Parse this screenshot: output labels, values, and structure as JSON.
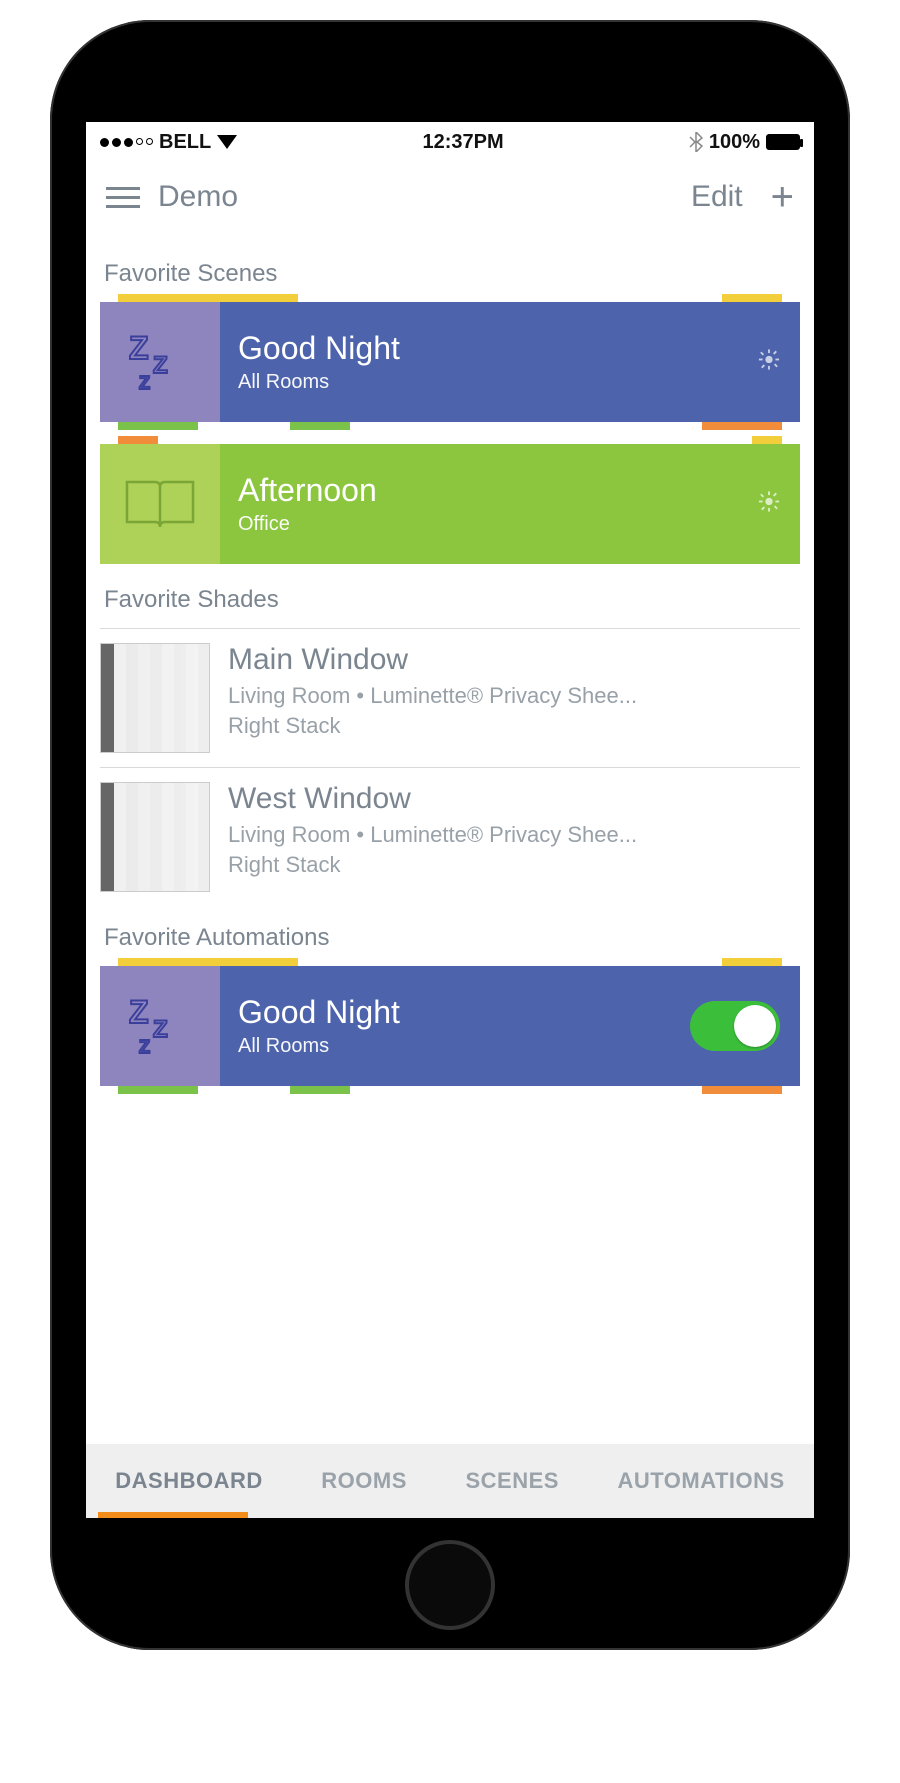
{
  "status": {
    "carrier": "BELL",
    "time": "12:37PM",
    "battery_pct": "100%"
  },
  "nav": {
    "title": "Demo",
    "edit": "Edit"
  },
  "sections": {
    "scenes_title": "Favorite Scenes",
    "shades_title": "Favorite Shades",
    "automations_title": "Favorite Automations"
  },
  "scenes": [
    {
      "title": "Good Night",
      "subtitle": "All Rooms",
      "icon_box_color": "#8f85be",
      "body_color": "#4d63ab",
      "icon": "zz"
    },
    {
      "title": "Afternoon",
      "subtitle": "Office",
      "icon_box_color": "#aed158",
      "body_color": "#8cc63f",
      "icon": "book"
    }
  ],
  "shades": [
    {
      "name": "Main Window",
      "meta1": "Living Room • Luminette® Privacy Shee...",
      "meta2": "Right Stack"
    },
    {
      "name": "West Window",
      "meta1": "Living Room • Luminette® Privacy Shee...",
      "meta2": "Right Stack"
    }
  ],
  "automations": [
    {
      "title": "Good Night",
      "subtitle": "All Rooms",
      "icon_box_color": "#8f85be",
      "body_color": "#4d63ab",
      "icon": "zz",
      "enabled": true
    }
  ],
  "tabs": [
    {
      "label": "DASHBOARD",
      "active": true
    },
    {
      "label": "ROOMS",
      "active": false
    },
    {
      "label": "SCENES",
      "active": false
    },
    {
      "label": "AUTOMATIONS",
      "active": false
    }
  ]
}
